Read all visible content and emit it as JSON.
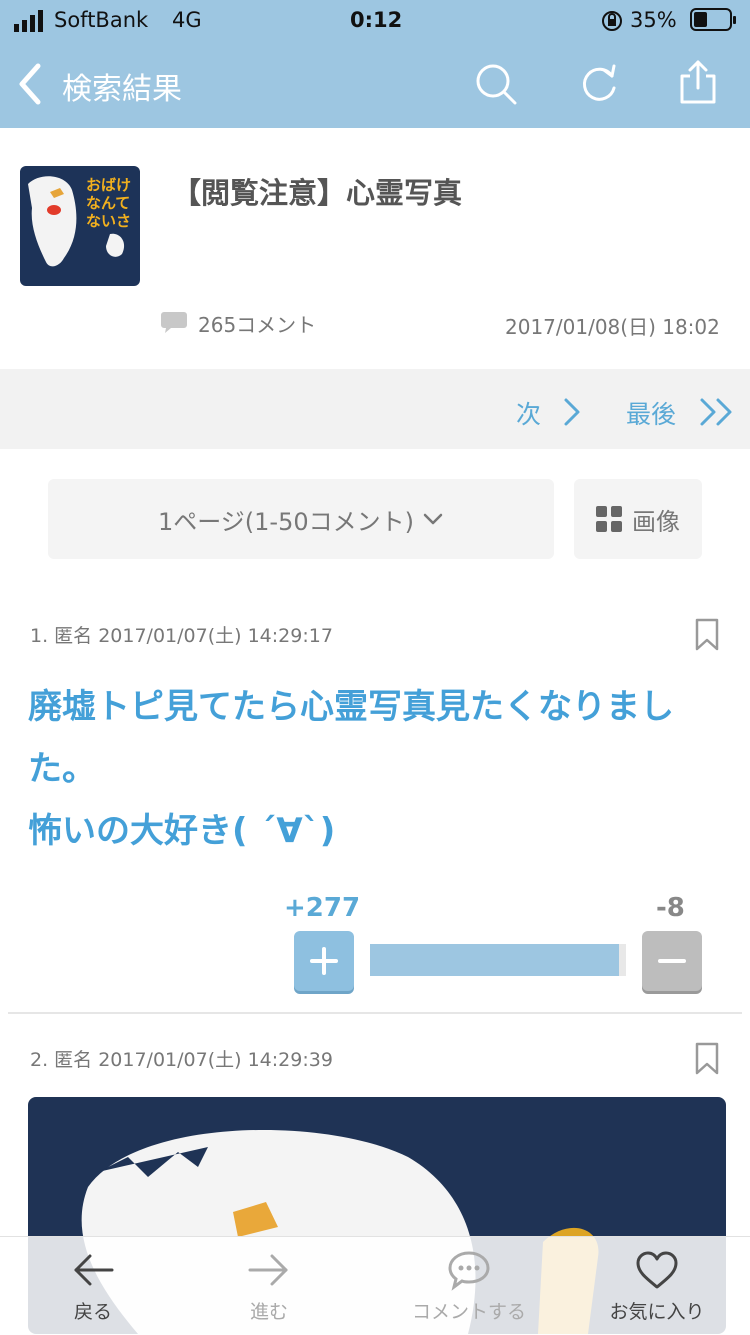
{
  "status": {
    "carrier": "SoftBank",
    "network": "4G",
    "time": "0:12",
    "battery": "35%"
  },
  "nav": {
    "back_label": "検索結果"
  },
  "topic": {
    "thumb_text": "おばけなんてないさ",
    "title": "【閲覧注意】心霊写真",
    "comment_count": "265コメント",
    "date": "2017/01/08(日) 18:02"
  },
  "pager": {
    "next_label": "次",
    "last_label": "最後",
    "select_label": "1ページ(1-50コメント)",
    "image_label": "画像"
  },
  "comments": [
    {
      "header": "1. 匿名 2017/01/07(土) 14:29:17",
      "body": [
        "廃墟トピ見てたら心霊写真見たくなりました。",
        "怖いの大好き( ´∀`)"
      ],
      "plus": "+277",
      "minus": "-8",
      "plus_value": 277,
      "minus_value": 8
    },
    {
      "header": "2. 匿名 2017/01/07(土) 14:29:39"
    }
  ],
  "bottom_nav": {
    "back": "戻る",
    "forward": "進む",
    "comment": "コメントする",
    "favorite": "お気に入り"
  },
  "colors": {
    "nav_bg": "#9dc6e1",
    "accent": "#44a0d8",
    "minus": "#bdbdbd"
  }
}
